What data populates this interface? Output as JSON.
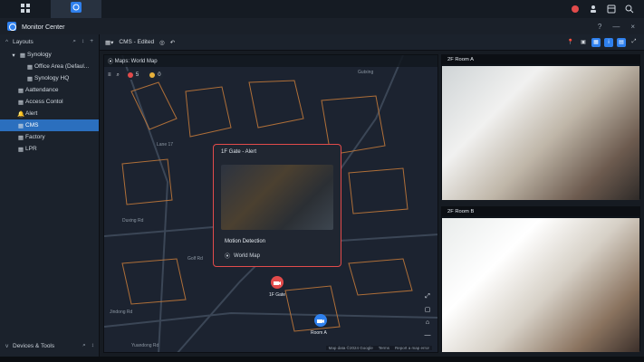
{
  "app": {
    "title": "Monitor Center"
  },
  "topbar": {
    "icons": [
      "apps-grid-icon",
      "surveillance-app-icon"
    ],
    "system_icons": [
      "notification-icon",
      "user-icon",
      "widgets-icon",
      "search-icon"
    ]
  },
  "sidebar": {
    "layouts_label": "Layouts",
    "tree": [
      {
        "label": "Synology",
        "level": 1
      },
      {
        "label": "Office Area (Defaul...",
        "level": 2
      },
      {
        "label": "Synology HQ",
        "level": 2
      },
      {
        "label": "Aattendance",
        "level": 1
      },
      {
        "label": "Access Contol",
        "level": 1
      },
      {
        "label": "Alert",
        "level": 1
      },
      {
        "label": "CMS",
        "level": 1,
        "selected": true
      },
      {
        "label": "Factory",
        "level": 1
      },
      {
        "label": "LPR",
        "level": 1
      }
    ],
    "devices_label": "Devices & Tools"
  },
  "main": {
    "toolbar": {
      "layout_name": "CMS - Edited"
    },
    "map": {
      "header": "Maps: World Map",
      "alerts": {
        "red_count": "5",
        "yellow_count": "0"
      },
      "popup": {
        "title": "1F Gate - Alert",
        "event": "Motion Detection",
        "location": "World Map"
      },
      "markers": {
        "gate_label": "1F Gate",
        "roomA_label": "Room A"
      },
      "street_labels": [
        "Duxing Rd",
        "Golf Rd",
        "Jindong Rd",
        "Yuandong Rd",
        "Gutxing",
        "Lane 17"
      ],
      "footer": [
        "Map data ©2024 Google",
        "Terms",
        "Report a map error"
      ]
    },
    "cameras": [
      {
        "title": "2F Room A"
      },
      {
        "title": "2F Room B"
      }
    ]
  },
  "colors": {
    "accent_blue": "#2f80ed",
    "alert_red": "#e24b4b",
    "sidebar_bg": "#1b222c",
    "map_bg": "#1c2330"
  }
}
